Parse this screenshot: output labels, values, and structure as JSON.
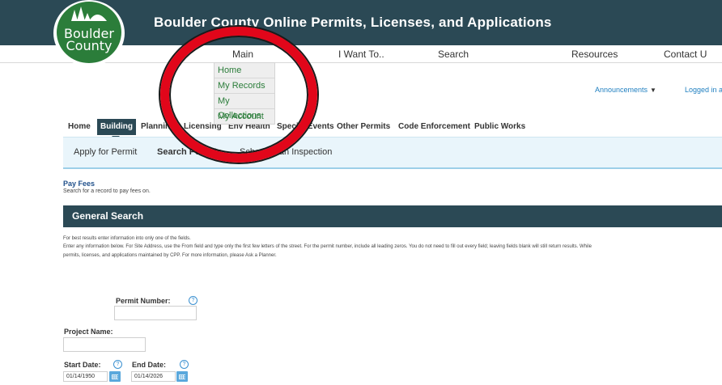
{
  "header": {
    "logo_line1": "Boulder",
    "logo_line2": "County",
    "title": "Boulder County Online Permits, Licenses, and Applications"
  },
  "main_nav": [
    "Main",
    "I Want To..",
    "Search",
    "Resources",
    "Contact U"
  ],
  "dropdown": [
    "Home",
    "My Records",
    "My Collections",
    "My Account"
  ],
  "announcements": "Announcements",
  "logged_in": "Logged in as",
  "tabs": [
    "Home",
    "Building",
    "Planning",
    "Licensing",
    "Env Health",
    "Special Events",
    "Other Permits",
    "Code Enforcement",
    "Public Works"
  ],
  "active_tab": "Building",
  "sub_nav": [
    "Apply for Permit",
    "Search Permits",
    "Schedule an Inspection"
  ],
  "pay_fees": {
    "title": "Pay Fees",
    "subtitle": "Search for a record to pay fees on."
  },
  "general_search": {
    "title": "General Search",
    "instructions": [
      "For best results enter information into only one of the fields.",
      "Enter any information below. For Site Address, use the From field and type only the first few letters of the street. For the permit number, include all leading zeros. You do not need to fill out every field; leaving fields blank will still return results. While",
      "permits, licenses, and applications maintained by CPP. For more information, please Ask a Planner."
    ]
  },
  "form": {
    "permit_number_label": "Permit Number:",
    "permit_number_value": "",
    "project_name_label": "Project Name:",
    "project_name_value": "",
    "start_date_label": "Start Date:",
    "start_date_value": "01/14/1950",
    "end_date_label": "End Date:",
    "end_date_value": "01/14/2026",
    "help_glyph": "?"
  },
  "colors": {
    "header_bg": "#2b4955",
    "logo_green": "#2b7d3a",
    "link_blue": "#1f7fc0",
    "subnav_bg": "#e9f5fb",
    "annotation_red": "#e1061a"
  }
}
